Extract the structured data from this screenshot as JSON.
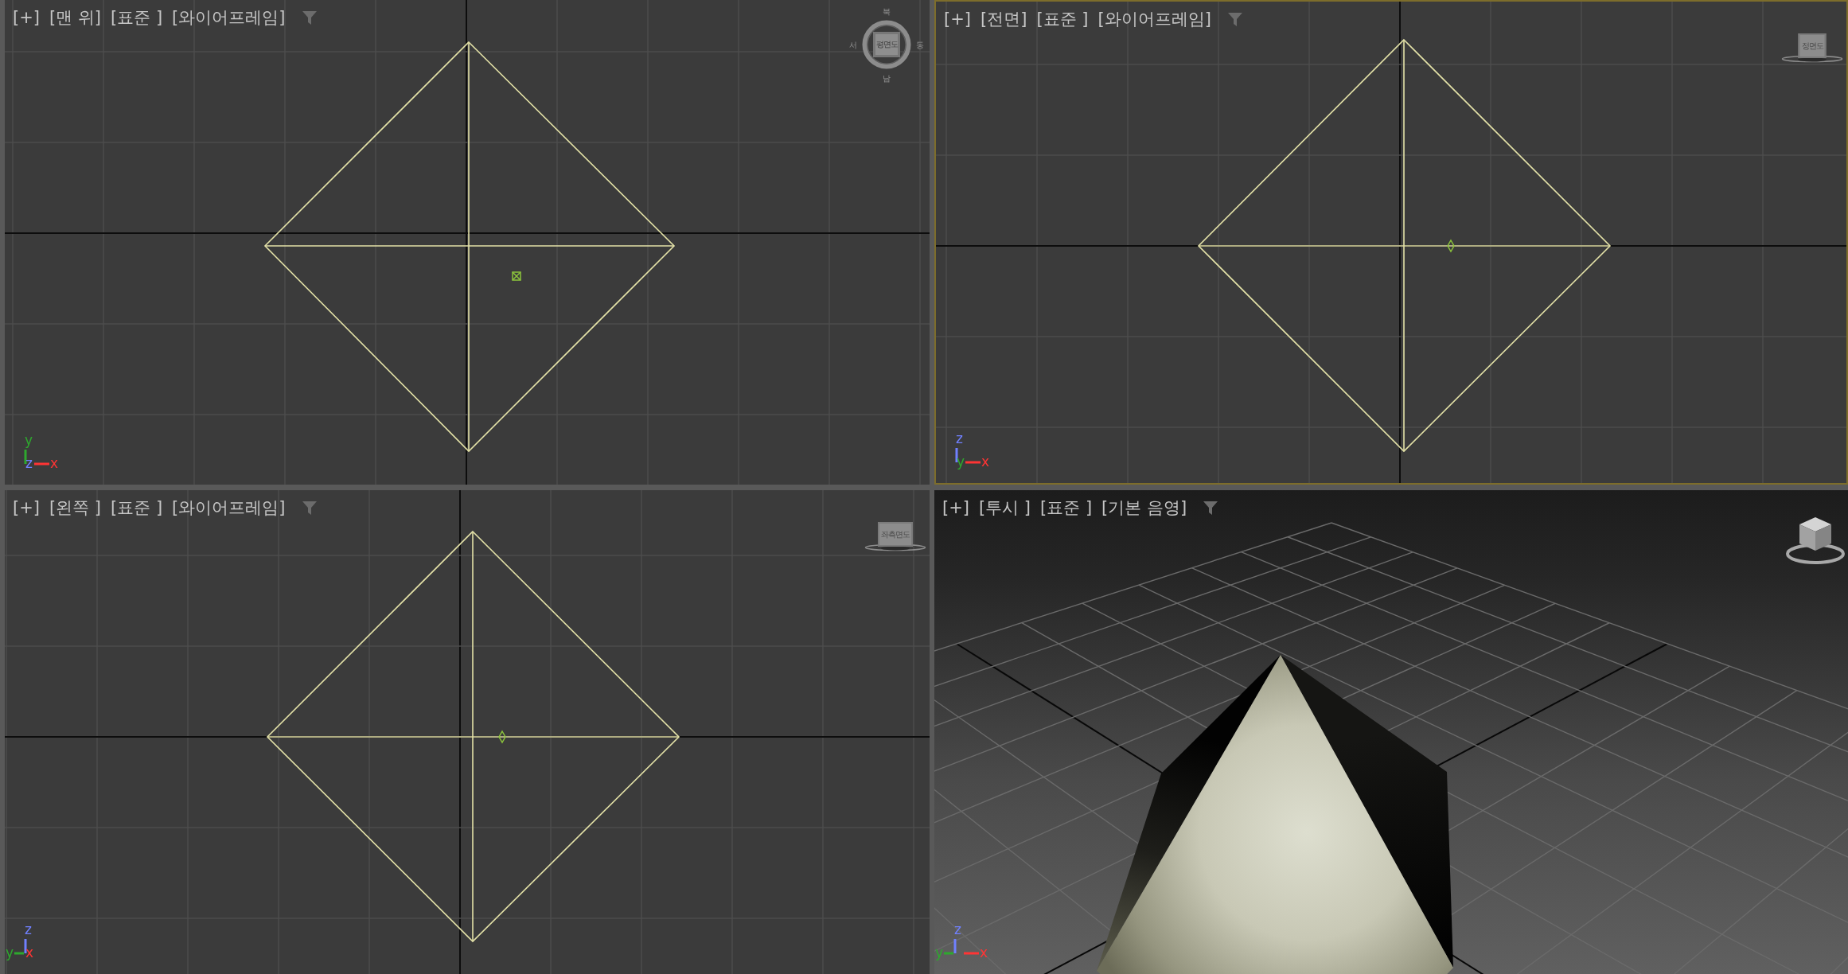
{
  "viewports": [
    {
      "kind": "wireframe",
      "selected": false,
      "menus": [
        "[+]",
        "[맨 위]",
        "[표준 ]",
        "[와이어프레임]"
      ],
      "pivot": {
        "kind": "box"
      },
      "view_cube": {
        "kind": "compass",
        "face": "평면도",
        "compass": [
          {
            "label": "북",
            "kind": "top"
          },
          {
            "label": "서",
            "kind": "left"
          },
          {
            "label": "동",
            "kind": "right"
          },
          {
            "label": "남",
            "kind": "bottom"
          }
        ]
      },
      "axes": [
        {
          "label": "y",
          "color": "#2ea82e",
          "kind": "up"
        },
        {
          "label": "z",
          "color": "#7080ff",
          "kind": "origin"
        },
        {
          "label": "x",
          "color": "#ff3434",
          "kind": "right"
        }
      ]
    },
    {
      "kind": "wireframe",
      "selected": true,
      "menus": [
        "[+]",
        "[전면]",
        "[표준 ]",
        "[와이어프레임]"
      ],
      "pivot": {
        "kind": "diamond"
      },
      "view_cube": {
        "kind": "cube",
        "face": "정면도"
      },
      "axes": [
        {
          "label": "z",
          "color": "#7080ff",
          "kind": "up"
        },
        {
          "label": "y",
          "color": "#2ea82e",
          "kind": "origin"
        },
        {
          "label": "x",
          "color": "#ff3434",
          "kind": "right"
        }
      ]
    },
    {
      "kind": "wireframe",
      "selected": false,
      "menus": [
        "[+]",
        "[왼쪽 ]",
        "[표준 ]",
        "[와이어프레임]"
      ],
      "pivot": {
        "kind": "diamond"
      },
      "view_cube": {
        "kind": "cube",
        "face": "좌측면도"
      },
      "axes": [
        {
          "label": "z",
          "color": "#7080ff",
          "kind": "up"
        },
        {
          "label": "y",
          "color": "#2ea82e",
          "kind": "left"
        },
        {
          "label": "x",
          "color": "#ff3434",
          "kind": "origin"
        }
      ]
    },
    {
      "kind": "perspective",
      "selected": false,
      "menus": [
        "[+]",
        "[투시 ]",
        "[표준 ]",
        "[기본 음영]"
      ],
      "view_cube": {
        "kind": "cube3d"
      },
      "axes": [
        {
          "label": "z",
          "color": "#7080ff",
          "kind": "up"
        },
        {
          "label": "y",
          "color": "#2ea82e",
          "kind": "left"
        },
        {
          "label": "x",
          "color": "#ff3434",
          "kind": "right"
        }
      ]
    }
  ]
}
